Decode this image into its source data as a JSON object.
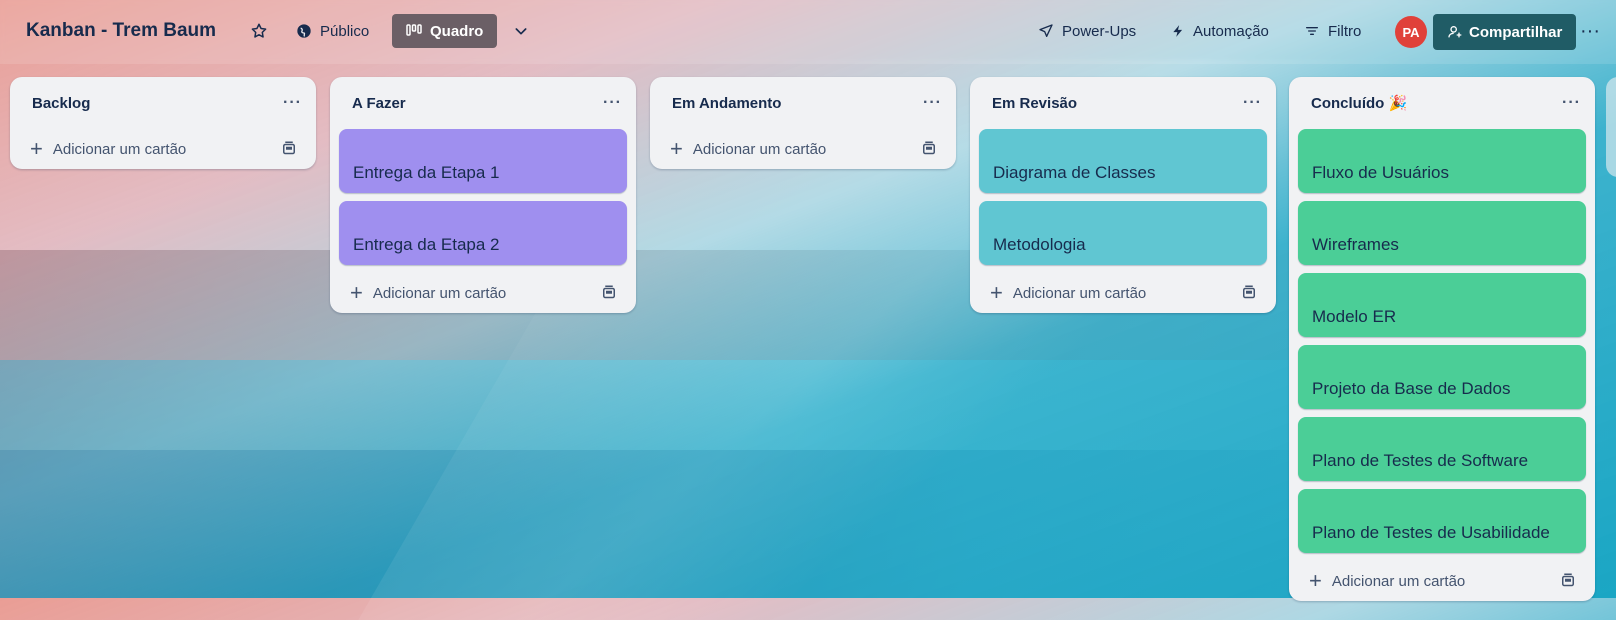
{
  "header": {
    "board_title": "Kanban - Trem Baum",
    "visibility_label": "Público",
    "view_label": "Quadro",
    "powerups_label": "Power-Ups",
    "automation_label": "Automação",
    "filter_label": "Filtro",
    "avatar_initials": "PA",
    "share_label": "Compartilhar",
    "more_label": "···"
  },
  "add_card_label": "Adicionar um cartão",
  "list_menu_label": "···",
  "lists": [
    {
      "title": "Backlog",
      "cards": []
    },
    {
      "title": "A Fazer",
      "cards": [
        "Entrega da Etapa 1",
        "Entrega da Etapa 2"
      ],
      "card_color": "#9f8fef"
    },
    {
      "title": "Em Andamento",
      "cards": []
    },
    {
      "title": "Em Revisão",
      "cards": [
        "Diagrama de Classes",
        "Metodologia"
      ],
      "card_color": "#60c6d2"
    },
    {
      "title": "Concluído 🎉",
      "cards": [
        "Fluxo de Usuários",
        "Wireframes",
        "Modelo ER",
        "Projeto da Base de Dados",
        "Plano de Testes de Software",
        "Plano de Testes de Usabilidade"
      ],
      "card_color": "#4bce97"
    }
  ],
  "colors": {
    "avatar_bg": "#e0413a",
    "share_bg": "#205c66",
    "view_bg": "#6b5f66"
  }
}
